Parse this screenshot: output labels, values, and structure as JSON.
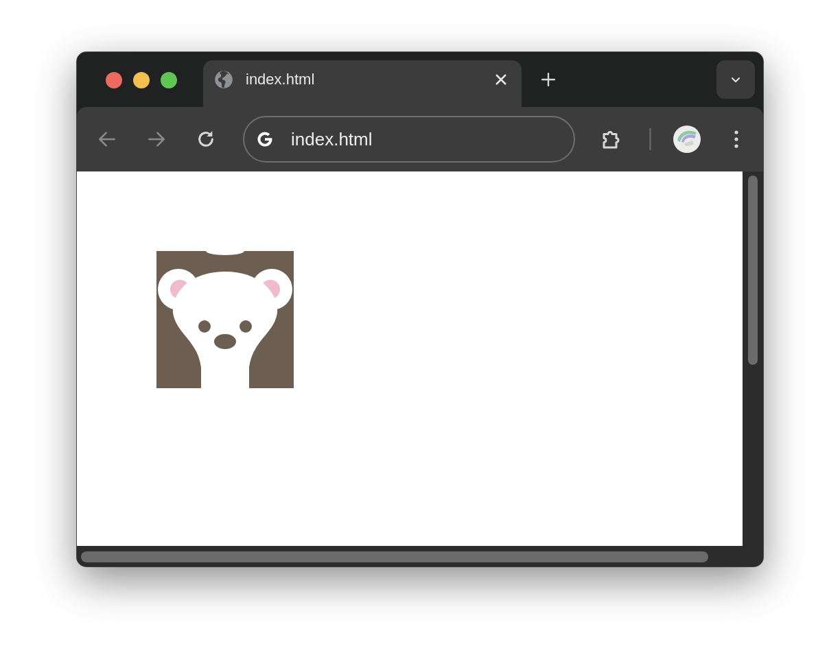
{
  "tabs": [
    {
      "title": "index.html",
      "selected": true
    }
  ],
  "address_bar": {
    "value": "index.html"
  }
}
